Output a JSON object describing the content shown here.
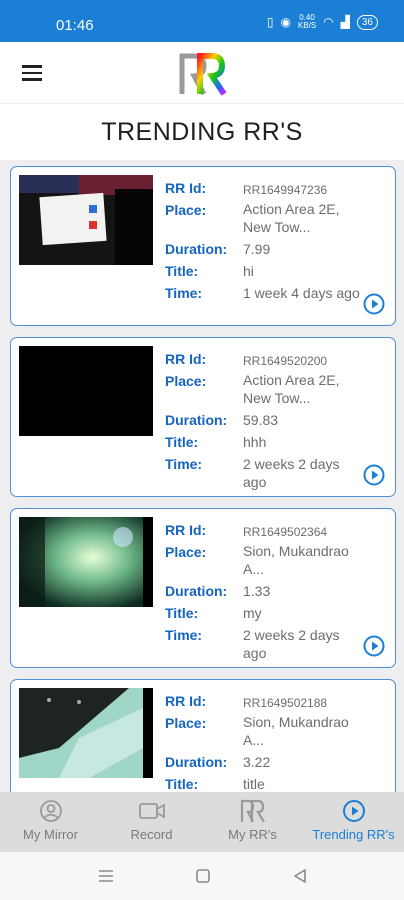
{
  "status_bar": {
    "time": "01:46",
    "battery": "36",
    "data_speed_top": "0.40",
    "data_speed_bottom": "KB/S"
  },
  "page": {
    "title": "TRENDING RR'S"
  },
  "labels": {
    "id": "RR Id:",
    "place": "Place:",
    "duration": "Duration:",
    "title": "Title:",
    "time": "Time:"
  },
  "cards": [
    {
      "id": "RR1649947236",
      "place": "Action Area 2E, New Tow...",
      "duration": "7.99",
      "title": "hi",
      "time": "1 week 4 days ago"
    },
    {
      "id": "RR1649520200",
      "place": "Action Area 2E, New Tow...",
      "duration": "59.83",
      "title": "hhh",
      "time": "2 weeks 2 days ago"
    },
    {
      "id": "RR1649502364",
      "place": "Sion, Mukandrao A...",
      "duration": "1.33",
      "title": "my",
      "time": "2 weeks 2 days ago"
    },
    {
      "id": "RR1649502188",
      "place": "Sion, Mukandrao A...",
      "duration": "3.22",
      "title": "title",
      "time": ""
    }
  ],
  "bottom_nav": [
    {
      "label": "My Mirror",
      "icon": "person-circle-icon"
    },
    {
      "label": "Record",
      "icon": "video-camera-icon"
    },
    {
      "label": "My RR's",
      "icon": "rr-logo-icon"
    },
    {
      "label": "Trending RR's",
      "icon": "play-circle-icon",
      "active": true
    }
  ],
  "colors": {
    "primary": "#1b7fd6",
    "label": "#1565c0",
    "card_border": "#4a90d9"
  }
}
